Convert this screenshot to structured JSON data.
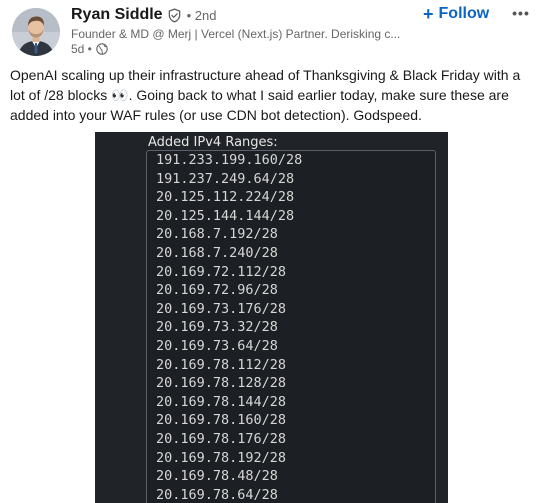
{
  "author": {
    "name": "Ryan Siddle",
    "verified_icon": "shield-check-icon",
    "degree": "• 2nd",
    "headline": "Founder & MD @ Merj | Vercel (Next.js) Partner. Derisking c...",
    "time": "5d •",
    "visibility_icon": "globe-icon"
  },
  "actions": {
    "follow_label": "Follow",
    "follow_icon": "plus-icon",
    "more_icon": "ellipsis-icon",
    "more_label": "•••"
  },
  "post": {
    "text": "OpenAI scaling up their infrastructure ahead of Thanksgiving & Black Friday with a lot of /28 blocks 👀. Going back to what I said earlier today, make sure these are added into your WAF rules (or use CDN bot detection). Godspeed."
  },
  "image": {
    "faded_header": "• • •••",
    "title": "Added IPv4 Ranges:",
    "ranges": [
      "191.233.199.160/28",
      "191.237.249.64/28",
      "20.125.112.224/28",
      "20.125.144.144/28",
      "20.168.7.192/28",
      "20.168.7.240/28",
      "20.169.72.112/28",
      "20.169.72.96/28",
      "20.169.73.176/28",
      "20.169.73.32/28",
      "20.169.73.64/28",
      "20.169.78.112/28",
      "20.169.78.128/28",
      "20.169.78.144/28",
      "20.169.78.160/28",
      "20.169.78.176/28",
      "20.169.78.192/28",
      "20.169.78.48/28",
      "20.169.78.64/28"
    ],
    "colors": {
      "background": "#202327",
      "text": "#d6d6d6",
      "border": "#5c6066"
    }
  },
  "colors": {
    "accent": "#0a66c2",
    "muted": "#666666",
    "text": "#191919"
  }
}
